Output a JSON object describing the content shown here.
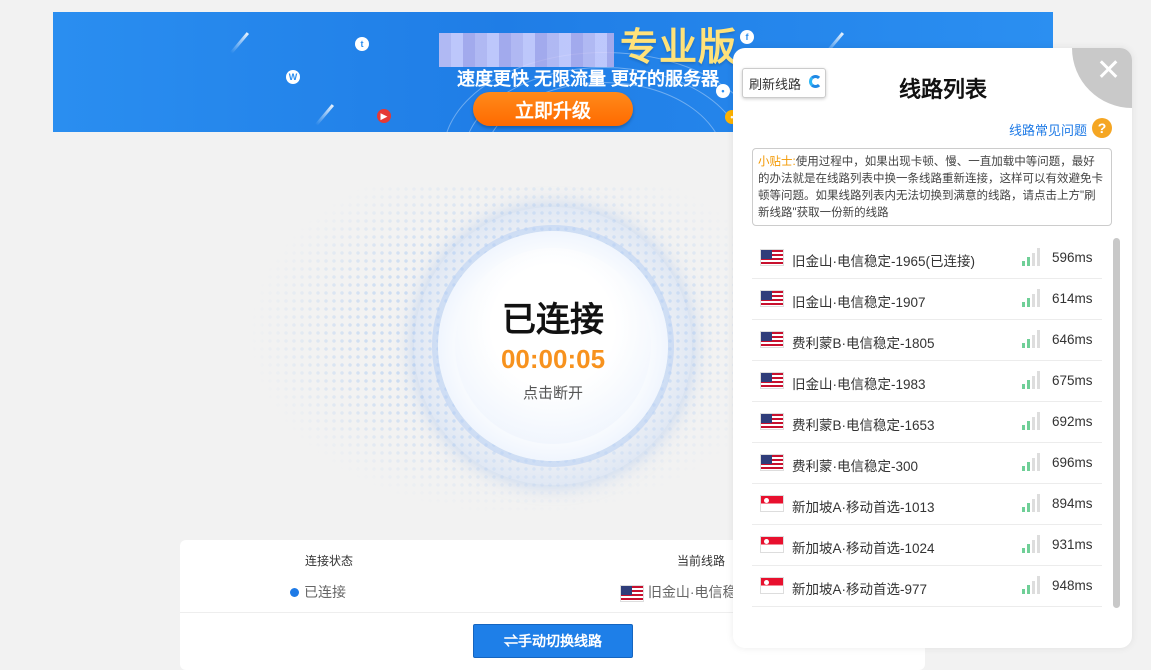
{
  "banner": {
    "title_suffix": "专业版",
    "subtitle": "速度更快 无限流量 更好的服务器",
    "upgrade_label": "立即升级"
  },
  "connection": {
    "status": "已连接",
    "timer": "00:00:05",
    "action": "点击断开"
  },
  "info": {
    "status_header": "连接状态",
    "status_value": "已连接",
    "route_header": "当前线路",
    "route_value": "旧金山·电信稳",
    "switch_label": "⇌手动切换线路"
  },
  "panel": {
    "refresh_label": "刷新线路",
    "title": "线路列表",
    "faq_label": "线路常见问题",
    "help_glyph": "?",
    "close_glyph": "✕",
    "tip_label": "小贴士:",
    "tip_text": "使用过程中，如果出现卡顿、慢、一直加载中等问题，最好的办法就是在线路列表中换一条线路重新连接，这样可以有效避免卡顿等问题。如果线路列表内无法切换到满意的线路，请点击上方\"刷新线路\"获取一份新的线路"
  },
  "routes": [
    {
      "flag": "us",
      "name": "旧金山·电信稳定-1965(已连接)",
      "latency": "596ms"
    },
    {
      "flag": "us",
      "name": "旧金山·电信稳定-1907",
      "latency": "614ms"
    },
    {
      "flag": "us",
      "name": "费利蒙B·电信稳定-1805",
      "latency": "646ms"
    },
    {
      "flag": "us",
      "name": "旧金山·电信稳定-1983",
      "latency": "675ms"
    },
    {
      "flag": "us",
      "name": "费利蒙B·电信稳定-1653",
      "latency": "692ms"
    },
    {
      "flag": "us",
      "name": "费利蒙·电信稳定-300",
      "latency": "696ms"
    },
    {
      "flag": "sg",
      "name": "新加坡A·移动首选-1013",
      "latency": "894ms"
    },
    {
      "flag": "sg",
      "name": "新加坡A·移动首选-1024",
      "latency": "931ms"
    },
    {
      "flag": "sg",
      "name": "新加坡A·移动首选-977",
      "latency": "948ms"
    }
  ],
  "colors": {
    "accent": "#1e7ae6",
    "timer": "#f7921e",
    "upgrade": "#ff7a00"
  }
}
